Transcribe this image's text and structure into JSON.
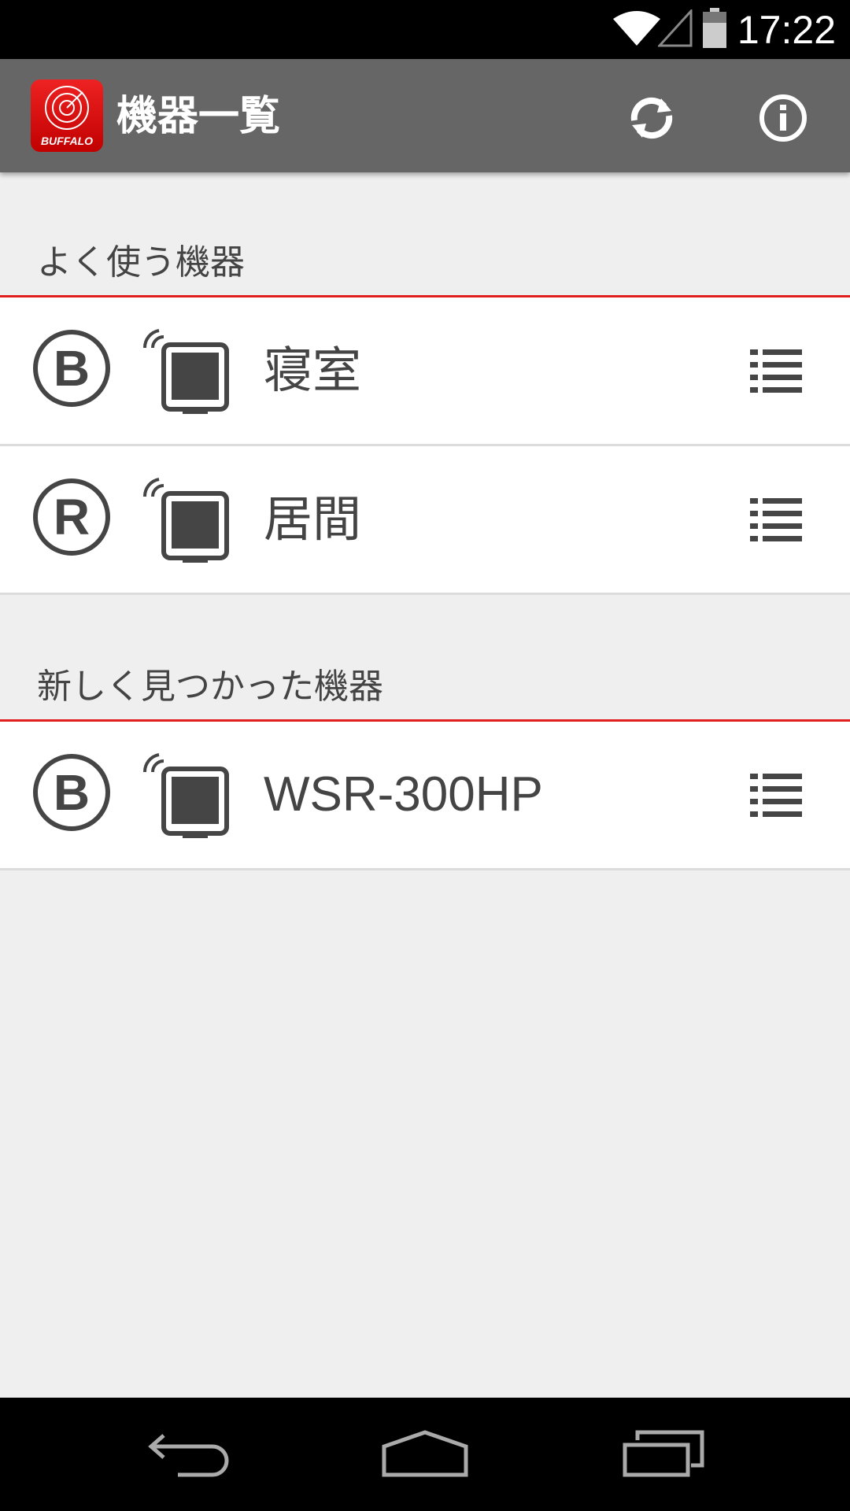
{
  "status_bar": {
    "time": "17:22",
    "icons": [
      "wifi-icon",
      "cell-signal-icon",
      "battery-icon"
    ]
  },
  "app_bar": {
    "logo_text": "BUFFALO",
    "title": "機器一覧",
    "actions": [
      "refresh-icon",
      "info-icon"
    ]
  },
  "sections": [
    {
      "header": "よく使う機器",
      "devices": [
        {
          "badge": "B",
          "name": "寝室"
        },
        {
          "badge": "R",
          "name": "居間"
        }
      ]
    },
    {
      "header": "新しく見つかった機器",
      "devices": [
        {
          "badge": "B",
          "name": "WSR-300HP"
        }
      ]
    }
  ],
  "nav_bar": {
    "buttons": [
      "back-icon",
      "home-icon",
      "recent-apps-icon"
    ]
  },
  "colors": {
    "accent": "#e01e1e",
    "app_bar": "#666666",
    "background": "#efefef",
    "icon": "#454545"
  }
}
